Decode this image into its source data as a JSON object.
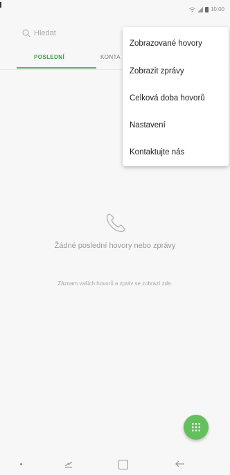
{
  "status_bar": {
    "time": "10:00",
    "icons": [
      "wifi-icon",
      "signal-icon",
      "battery-icon"
    ]
  },
  "search": {
    "placeholder": "Hledat"
  },
  "tabs": [
    {
      "label": "POSLEDNÍ",
      "active": true
    },
    {
      "label": "KONTA",
      "active": false
    }
  ],
  "overflow_menu": {
    "items": [
      {
        "label": "Zobrazované hovory"
      },
      {
        "label": "Zobrazit zprávy"
      },
      {
        "label": "Celková doba hovorů"
      },
      {
        "label": "Nastavení"
      },
      {
        "label": "Kontaktujte nás"
      }
    ]
  },
  "empty_state": {
    "icon": "phone-icon",
    "title": "Žádné poslední hovory nebo zprávy",
    "subtitle": "Záznam vašich hovorů a zpráv se zobrazí zde."
  },
  "fab": {
    "icon": "dialpad-icon"
  },
  "nav_bar": {
    "buttons": [
      "dot-icon",
      "recents-icon",
      "home-icon",
      "back-icon"
    ]
  },
  "colors": {
    "accent_green": "#5ab15a",
    "fab_green": "#63c05d",
    "background": "#f7f7f7"
  }
}
